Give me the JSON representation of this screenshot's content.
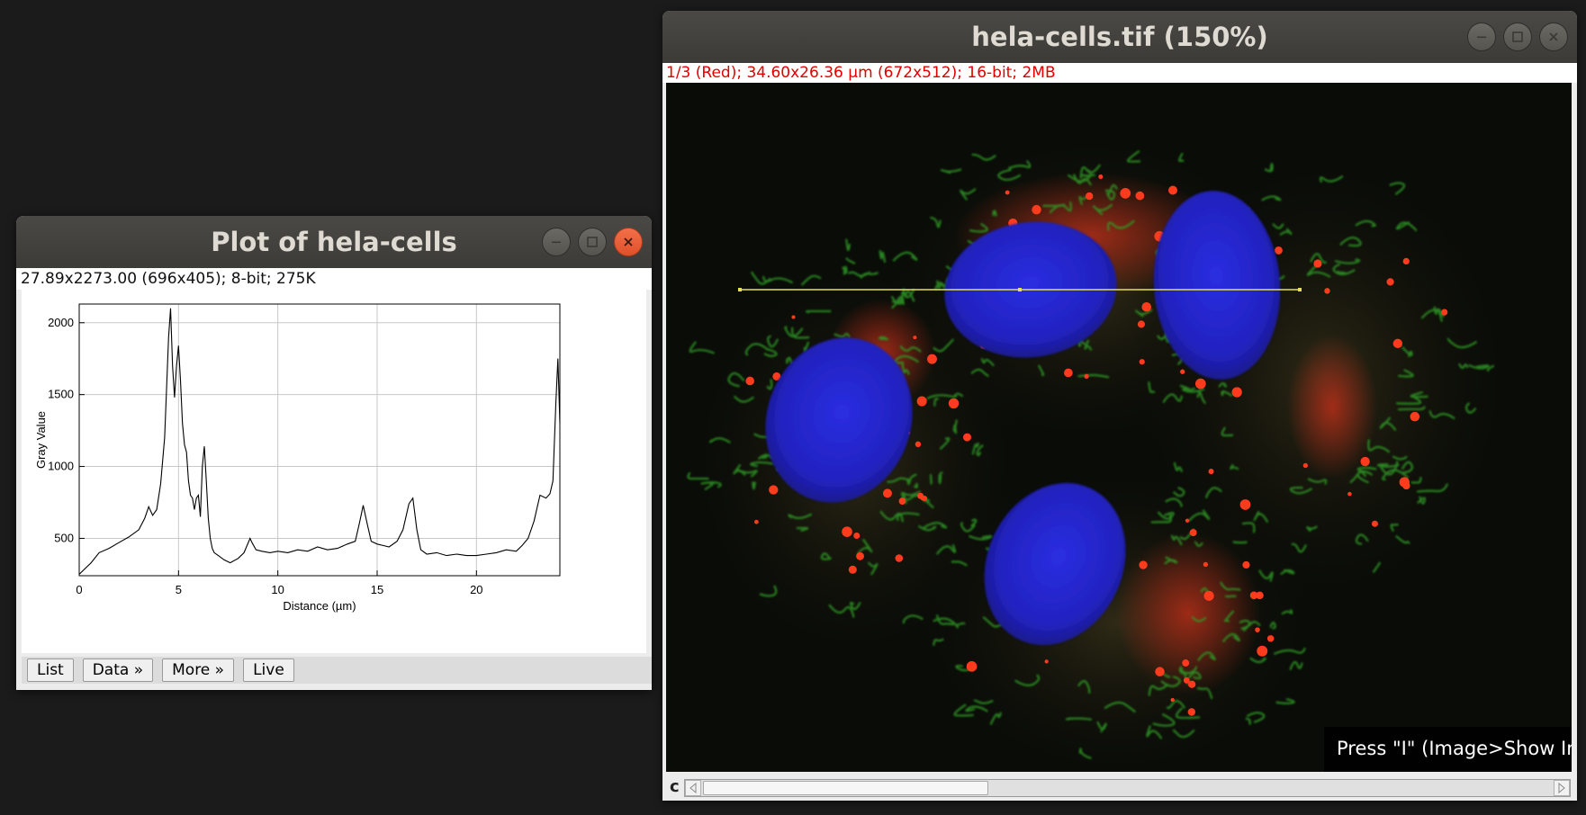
{
  "plot_window": {
    "title": "Plot of hela-cells",
    "info": "27.89x2273.00    (696x405); 8-bit; 275K",
    "buttons": {
      "list": "List",
      "data": "Data »",
      "more": "More »",
      "live": "Live"
    }
  },
  "image_window": {
    "title": "hela-cells.tif (150%)",
    "info": "1/3 (Red); 34.60x26.36 µm (672x512); 16-bit; 2MB",
    "overlay_text": "Press \"I\" (Image>Show Info) for informatio",
    "channel_label": "c",
    "scroll_position": 0.3
  },
  "chart_data": {
    "type": "line",
    "xlabel": "Distance (µm)",
    "ylabel": "Gray Value",
    "xlim": [
      0,
      24.2
    ],
    "ylim": [
      240,
      2130
    ],
    "xticks": [
      0,
      5,
      10,
      15,
      20
    ],
    "yticks": [
      500,
      1000,
      1500,
      2000
    ],
    "grid": true,
    "series": [
      {
        "x": [
          0,
          0.3,
          0.6,
          1.0,
          1.5,
          2.0,
          2.5,
          3.0,
          3.3,
          3.5,
          3.7,
          3.9,
          4.1,
          4.3,
          4.5,
          4.6,
          4.7,
          4.8,
          4.9,
          5.0,
          5.1,
          5.2,
          5.3,
          5.4,
          5.5,
          5.6,
          5.7,
          5.8,
          5.9,
          6.0,
          6.1,
          6.2,
          6.3,
          6.4,
          6.5,
          6.6,
          6.7,
          6.8,
          7.0,
          7.3,
          7.6,
          8.0,
          8.3,
          8.6,
          8.7,
          8.9,
          9.2,
          9.6,
          10.0,
          10.5,
          11.0,
          11.5,
          12.0,
          12.5,
          13.0,
          13.5,
          13.9,
          14.1,
          14.3,
          14.5,
          14.7,
          15.0,
          15.3,
          15.6,
          16.0,
          16.3,
          16.6,
          16.8,
          17.0,
          17.2,
          17.5,
          18.0,
          18.5,
          19.0,
          19.5,
          20.0,
          20.5,
          21.0,
          21.5,
          22.0,
          22.3,
          22.6,
          22.9,
          23.2,
          23.5,
          23.7,
          23.85,
          24.0,
          24.1,
          24.2
        ],
        "y": [
          250,
          290,
          330,
          400,
          430,
          470,
          510,
          560,
          640,
          720,
          660,
          700,
          880,
          1200,
          1900,
          2100,
          1700,
          1480,
          1700,
          1840,
          1600,
          1300,
          1150,
          1100,
          900,
          800,
          780,
          700,
          780,
          800,
          650,
          1000,
          1140,
          900,
          640,
          500,
          430,
          400,
          380,
          350,
          330,
          360,
          400,
          500,
          470,
          420,
          410,
          400,
          410,
          400,
          420,
          410,
          440,
          420,
          430,
          460,
          480,
          600,
          730,
          600,
          480,
          460,
          450,
          440,
          480,
          560,
          740,
          780,
          560,
          420,
          390,
          400,
          380,
          390,
          380,
          380,
          390,
          400,
          420,
          410,
          450,
          500,
          620,
          800,
          780,
          810,
          900,
          1450,
          1750,
          1300
        ]
      }
    ]
  }
}
